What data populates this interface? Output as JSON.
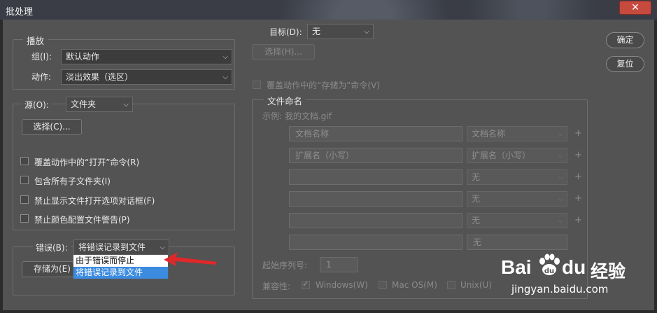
{
  "window": {
    "title": "批处理",
    "close_label": "✕"
  },
  "buttons": {
    "ok": "确定",
    "reset": "复位"
  },
  "play": {
    "legend": "播放",
    "group_label": "组(I):",
    "group_value": "默认动作",
    "action_label": "动作:",
    "action_value": "淡出效果（选区）"
  },
  "source": {
    "label": "源(O):",
    "value": "文件夹",
    "choose_button": "选择(C)...",
    "options": [
      "覆盖动作中的“打开”命令(R)",
      "包含所有子文件夹(I)",
      "禁止显示文件打开选项对话框(F)",
      "禁止颜色配置文件警告(P)"
    ]
  },
  "errors": {
    "label": "错误(B):",
    "value": "将错误记录到文件",
    "save_as_button": "存储为(E)",
    "dropdown_options": [
      "由于错误而停止",
      "将错误记录到文件"
    ]
  },
  "target": {
    "label": "目标(D):",
    "value": "无",
    "choose_button": "选择(H)...",
    "override_label": "覆盖动作中的“存储为”命令(V)"
  },
  "naming": {
    "legend": "文件命名",
    "example": "示例: 我的文档.gif",
    "rows": [
      {
        "text": "文档名称",
        "select": "文档名称"
      },
      {
        "text": "扩展名（小写）",
        "select": "扩展名（小写）"
      },
      {
        "text": "",
        "select": "无"
      },
      {
        "text": "",
        "select": "无"
      },
      {
        "text": "",
        "select": "无"
      },
      {
        "text": "",
        "select": "无"
      }
    ],
    "plus": "+",
    "start_serial_label": "起始序列号:",
    "start_serial_value": "1",
    "compat_label": "兼容性:",
    "compat": [
      "Windows(W)",
      "Mac OS(M)",
      "Unix(U)"
    ]
  },
  "watermark": {
    "brand_left": "Bai",
    "brand_right": "du",
    "brand_cn": "经验",
    "url": "jingyan.baidu.com"
  },
  "colors": {
    "panel": "#535353",
    "selection": "#3b8be0",
    "arrow": "#e0282a",
    "close": "#c74a3f"
  }
}
